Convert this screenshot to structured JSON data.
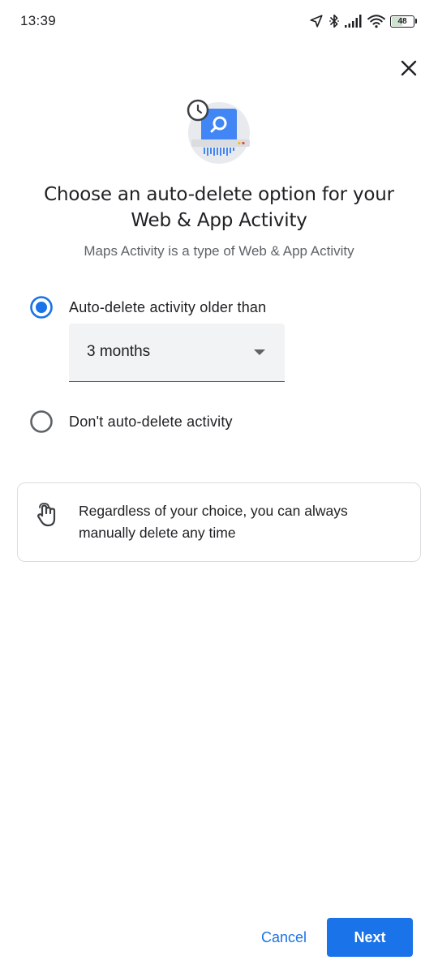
{
  "status_bar": {
    "time": "13:39",
    "battery_level": "48",
    "icons": [
      "location-arrow-icon",
      "bluetooth-icon",
      "signal-icon",
      "wifi-icon",
      "battery-icon"
    ]
  },
  "dialog": {
    "close_icon": "close-icon",
    "illustration_icon": "auto-delete-illustration",
    "title": "Choose an auto-delete option for your Web & App Activity",
    "subtitle": "Maps Activity is a type of Web & App Activity"
  },
  "options": [
    {
      "label": "Auto-delete activity older than",
      "selected": true
    },
    {
      "label": "Don't auto-delete activity",
      "selected": false
    }
  ],
  "dropdown": {
    "selected_value": "3 months"
  },
  "info_card": {
    "icon": "hand-pointer-icon",
    "text": "Regardless of your choice, you can always manually delete any time"
  },
  "buttons": {
    "cancel_label": "Cancel",
    "next_label": "Next"
  },
  "colors": {
    "accent": "#1a73e8",
    "text_primary": "#202124",
    "text_secondary": "#5f6368"
  }
}
